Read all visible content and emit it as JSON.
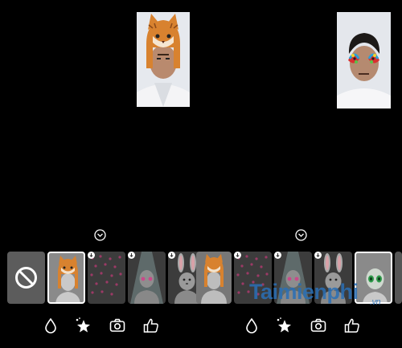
{
  "watermark": {
    "brand": "Taimienphi",
    "tld": ".vn"
  },
  "left_panel": {
    "filters": [
      {
        "name": "none",
        "icon": "no-filter-icon"
      },
      {
        "name": "cat-mask",
        "icon": "cat-mask-icon",
        "selected": true
      },
      {
        "name": "hearts",
        "icon": "hearts-icon",
        "download": true
      },
      {
        "name": "spotlight",
        "icon": "spotlight-icon",
        "download": true
      },
      {
        "name": "bunny-ears",
        "icon": "bunny-icon",
        "download": true
      },
      {
        "name": "cat-mask-2",
        "icon": "cat-mask-icon"
      }
    ],
    "toolbar": [
      "drop-icon",
      "sparkle-star-icon",
      "camera-icon",
      "thumbs-up-icon"
    ]
  },
  "right_panel": {
    "filters": [
      {
        "name": "hearts",
        "icon": "hearts-icon",
        "download": true
      },
      {
        "name": "spotlight",
        "icon": "spotlight-icon",
        "download": true
      },
      {
        "name": "bunny-ears",
        "icon": "bunny-icon",
        "download": true
      },
      {
        "name": "alien",
        "icon": "alien-icon",
        "selected": true
      }
    ],
    "toolbar": [
      "drop-icon",
      "sparkle-star-icon",
      "camera-icon",
      "thumbs-up-icon"
    ]
  }
}
